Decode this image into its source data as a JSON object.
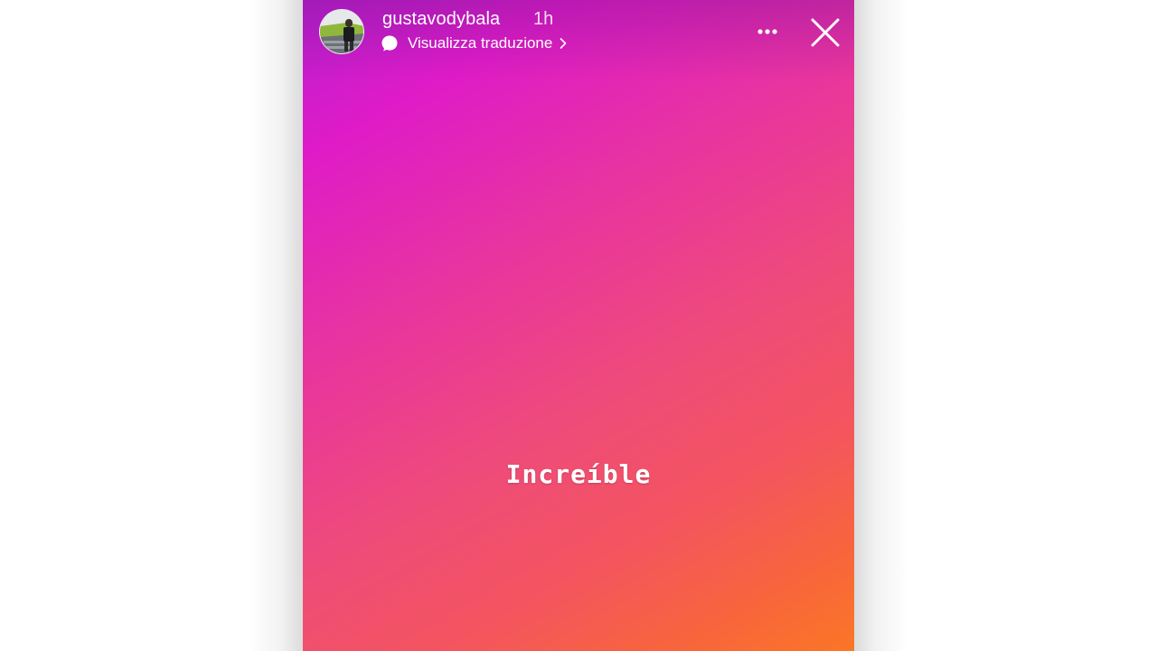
{
  "story": {
    "username": "gustavodybala",
    "time_ago": "1h",
    "translate_label": "Visualizza traduzione",
    "text": "Increíble",
    "gradient_colors": [
      "#b81fd0",
      "#df1bc8",
      "#ee4a7c",
      "#f4555e",
      "#fb7626"
    ]
  },
  "icons": {
    "avatar": "profile-photo",
    "translate": "speech-bubble-icon",
    "translate_chevron": "chevron-right-icon",
    "more": "more-horizontal-icon",
    "close": "close-icon"
  }
}
